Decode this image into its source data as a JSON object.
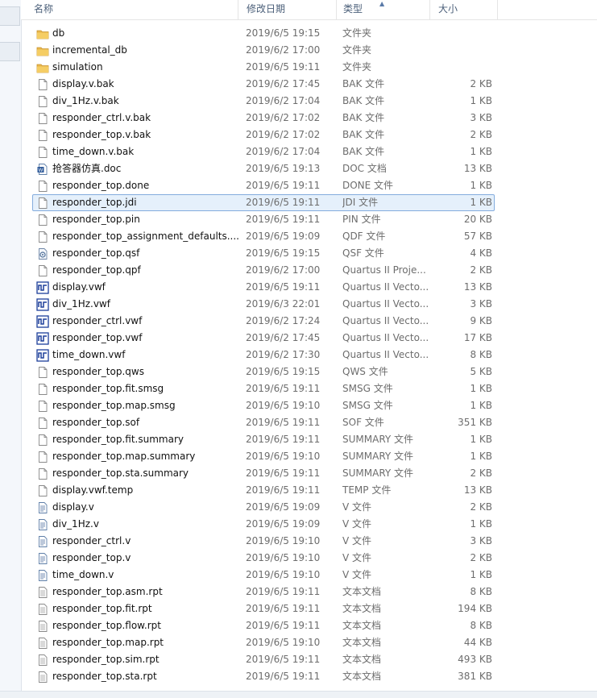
{
  "header": {
    "name": "名称",
    "date": "修改日期",
    "type": "类型",
    "size": "大小"
  },
  "files": [
    {
      "name": "db",
      "date": "2019/6/5 19:15",
      "type": "文件夹",
      "size": "",
      "icon": "folder-icon"
    },
    {
      "name": "incremental_db",
      "date": "2019/6/2 17:00",
      "type": "文件夹",
      "size": "",
      "icon": "folder-icon"
    },
    {
      "name": "simulation",
      "date": "2019/6/5 19:11",
      "type": "文件夹",
      "size": "",
      "icon": "folder-icon"
    },
    {
      "name": "display.v.bak",
      "date": "2019/6/2 17:45",
      "type": "BAK 文件",
      "size": "2 KB",
      "icon": "file-icon"
    },
    {
      "name": "div_1Hz.v.bak",
      "date": "2019/6/2 17:04",
      "type": "BAK 文件",
      "size": "1 KB",
      "icon": "file-icon"
    },
    {
      "name": "responder_ctrl.v.bak",
      "date": "2019/6/2 17:02",
      "type": "BAK 文件",
      "size": "3 KB",
      "icon": "file-icon"
    },
    {
      "name": "responder_top.v.bak",
      "date": "2019/6/2 17:02",
      "type": "BAK 文件",
      "size": "2 KB",
      "icon": "file-icon"
    },
    {
      "name": "time_down.v.bak",
      "date": "2019/6/2 17:04",
      "type": "BAK 文件",
      "size": "1 KB",
      "icon": "file-icon"
    },
    {
      "name": "抢答器仿真.doc",
      "date": "2019/6/5 19:13",
      "type": "DOC 文档",
      "size": "13 KB",
      "icon": "word-doc-icon"
    },
    {
      "name": "responder_top.done",
      "date": "2019/6/5 19:11",
      "type": "DONE 文件",
      "size": "1 KB",
      "icon": "file-icon"
    },
    {
      "name": "responder_top.jdi",
      "date": "2019/6/5 19:11",
      "type": "JDI 文件",
      "size": "1 KB",
      "icon": "file-icon",
      "selected": true
    },
    {
      "name": "responder_top.pin",
      "date": "2019/6/5 19:11",
      "type": "PIN 文件",
      "size": "20 KB",
      "icon": "file-icon"
    },
    {
      "name": "responder_top_assignment_defaults....",
      "date": "2019/6/5 19:09",
      "type": "QDF 文件",
      "size": "57 KB",
      "icon": "file-icon"
    },
    {
      "name": "responder_top.qsf",
      "date": "2019/6/5 19:15",
      "type": "QSF 文件",
      "size": "4 KB",
      "icon": "settings-file-icon"
    },
    {
      "name": "responder_top.qpf",
      "date": "2019/6/2 17:00",
      "type": "Quartus II Proje...",
      "size": "2 KB",
      "icon": "file-icon"
    },
    {
      "name": "display.vwf",
      "date": "2019/6/5 19:11",
      "type": "Quartus II Vecto...",
      "size": "13 KB",
      "icon": "waveform-icon"
    },
    {
      "name": "div_1Hz.vwf",
      "date": "2019/6/3 22:01",
      "type": "Quartus II Vecto...",
      "size": "3 KB",
      "icon": "waveform-icon"
    },
    {
      "name": "responder_ctrl.vwf",
      "date": "2019/6/2 17:24",
      "type": "Quartus II Vecto...",
      "size": "9 KB",
      "icon": "waveform-icon"
    },
    {
      "name": "responder_top.vwf",
      "date": "2019/6/2 17:45",
      "type": "Quartus II Vecto...",
      "size": "17 KB",
      "icon": "waveform-icon"
    },
    {
      "name": "time_down.vwf",
      "date": "2019/6/2 17:30",
      "type": "Quartus II Vecto...",
      "size": "8 KB",
      "icon": "waveform-icon"
    },
    {
      "name": "responder_top.qws",
      "date": "2019/6/5 19:15",
      "type": "QWS 文件",
      "size": "5 KB",
      "icon": "file-icon"
    },
    {
      "name": "responder_top.fit.smsg",
      "date": "2019/6/5 19:11",
      "type": "SMSG 文件",
      "size": "1 KB",
      "icon": "file-icon"
    },
    {
      "name": "responder_top.map.smsg",
      "date": "2019/6/5 19:10",
      "type": "SMSG 文件",
      "size": "1 KB",
      "icon": "file-icon"
    },
    {
      "name": "responder_top.sof",
      "date": "2019/6/5 19:11",
      "type": "SOF 文件",
      "size": "351 KB",
      "icon": "file-icon"
    },
    {
      "name": "responder_top.fit.summary",
      "date": "2019/6/5 19:11",
      "type": "SUMMARY 文件",
      "size": "1 KB",
      "icon": "file-icon"
    },
    {
      "name": "responder_top.map.summary",
      "date": "2019/6/5 19:10",
      "type": "SUMMARY 文件",
      "size": "1 KB",
      "icon": "file-icon"
    },
    {
      "name": "responder_top.sta.summary",
      "date": "2019/6/5 19:11",
      "type": "SUMMARY 文件",
      "size": "2 KB",
      "icon": "file-icon"
    },
    {
      "name": "display.vwf.temp",
      "date": "2019/6/5 19:11",
      "type": "TEMP 文件",
      "size": "13 KB",
      "icon": "file-icon"
    },
    {
      "name": "display.v",
      "date": "2019/6/5 19:09",
      "type": "V 文件",
      "size": "2 KB",
      "icon": "verilog-file-icon"
    },
    {
      "name": "div_1Hz.v",
      "date": "2019/6/5 19:09",
      "type": "V 文件",
      "size": "1 KB",
      "icon": "verilog-file-icon"
    },
    {
      "name": "responder_ctrl.v",
      "date": "2019/6/5 19:10",
      "type": "V 文件",
      "size": "3 KB",
      "icon": "verilog-file-icon"
    },
    {
      "name": "responder_top.v",
      "date": "2019/6/5 19:10",
      "type": "V 文件",
      "size": "2 KB",
      "icon": "verilog-file-icon"
    },
    {
      "name": "time_down.v",
      "date": "2019/6/5 19:10",
      "type": "V 文件",
      "size": "1 KB",
      "icon": "verilog-file-icon"
    },
    {
      "name": "responder_top.asm.rpt",
      "date": "2019/6/5 19:11",
      "type": "文本文档",
      "size": "8 KB",
      "icon": "text-doc-icon"
    },
    {
      "name": "responder_top.fit.rpt",
      "date": "2019/6/5 19:11",
      "type": "文本文档",
      "size": "194 KB",
      "icon": "text-doc-icon"
    },
    {
      "name": "responder_top.flow.rpt",
      "date": "2019/6/5 19:11",
      "type": "文本文档",
      "size": "8 KB",
      "icon": "text-doc-icon"
    },
    {
      "name": "responder_top.map.rpt",
      "date": "2019/6/5 19:10",
      "type": "文本文档",
      "size": "44 KB",
      "icon": "text-doc-icon"
    },
    {
      "name": "responder_top.sim.rpt",
      "date": "2019/6/5 19:11",
      "type": "文本文档",
      "size": "493 KB",
      "icon": "text-doc-icon"
    },
    {
      "name": "responder_top.sta.rpt",
      "date": "2019/6/5 19:11",
      "type": "文本文档",
      "size": "381 KB",
      "icon": "text-doc-icon"
    }
  ]
}
